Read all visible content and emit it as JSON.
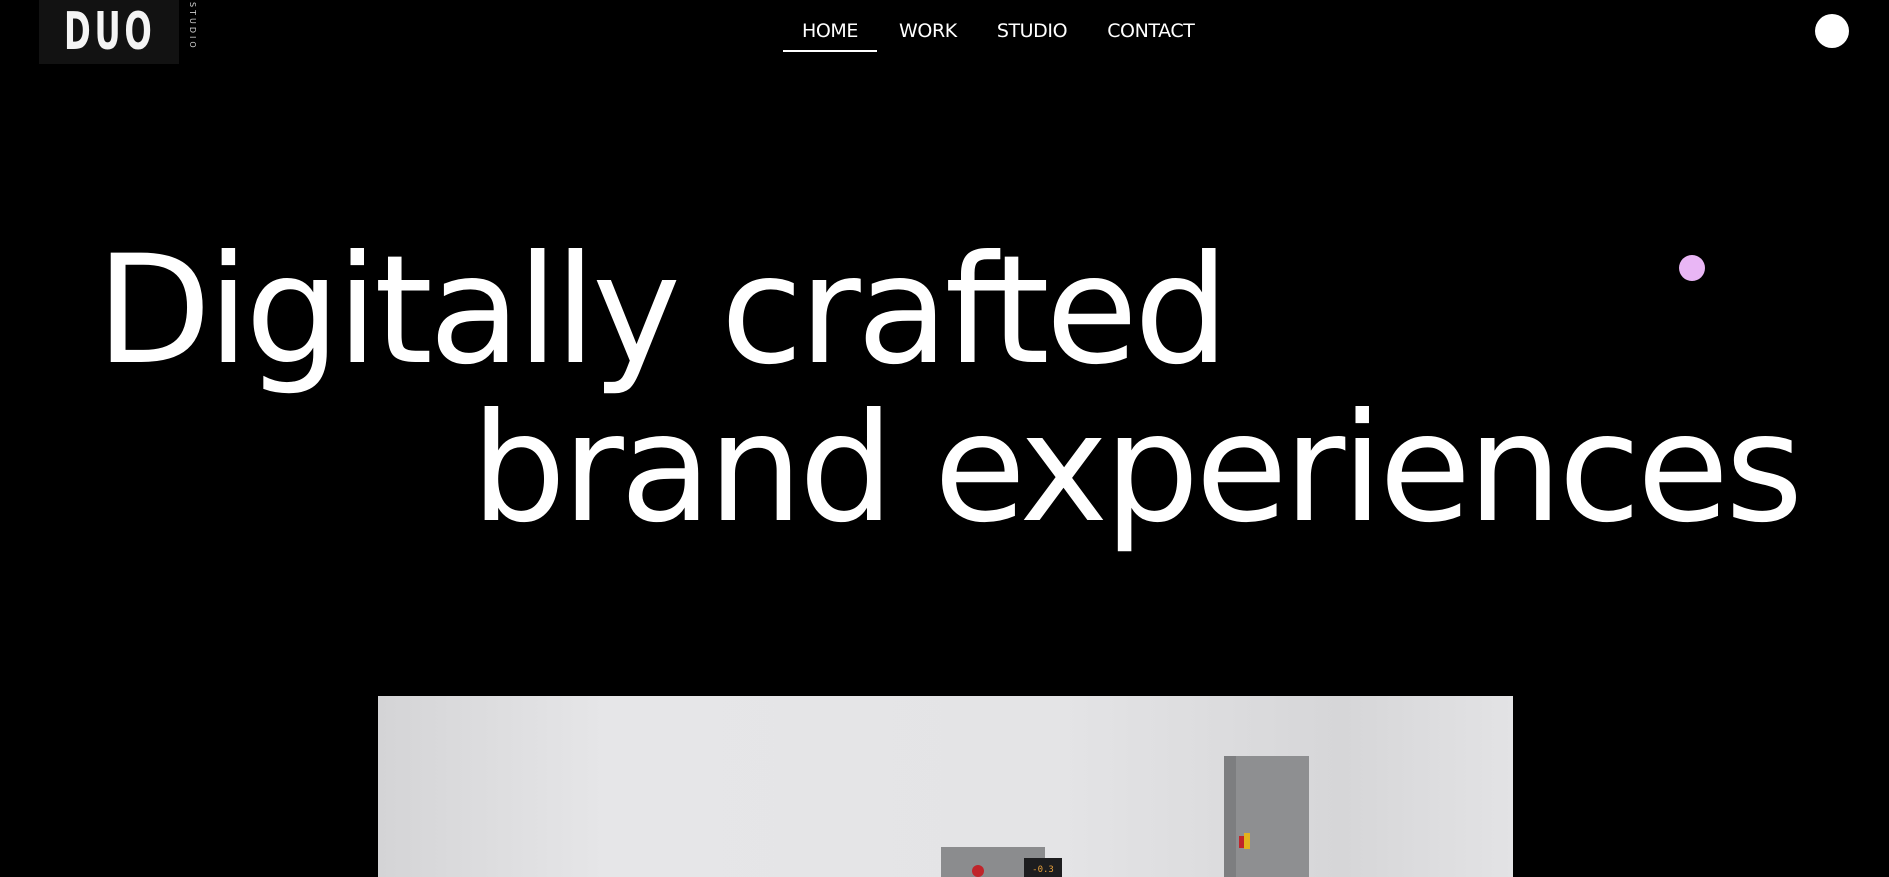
{
  "logo": {
    "main": "DUO",
    "sub": "STUDIO"
  },
  "nav": {
    "items": [
      {
        "label": "HOME",
        "active": true
      },
      {
        "label": "WORK",
        "active": false
      },
      {
        "label": "STUDIO",
        "active": false
      },
      {
        "label": "CONTACT",
        "active": false
      }
    ]
  },
  "hero": {
    "line1": "Digitally crafted",
    "line2": "brand experiences"
  },
  "image": {
    "display": "-0.3"
  },
  "colors": {
    "background": "#000000",
    "text": "#ffffff",
    "accent_dot": "#e9b6f5"
  },
  "icons": {
    "menu": "menu-circle-icon"
  }
}
